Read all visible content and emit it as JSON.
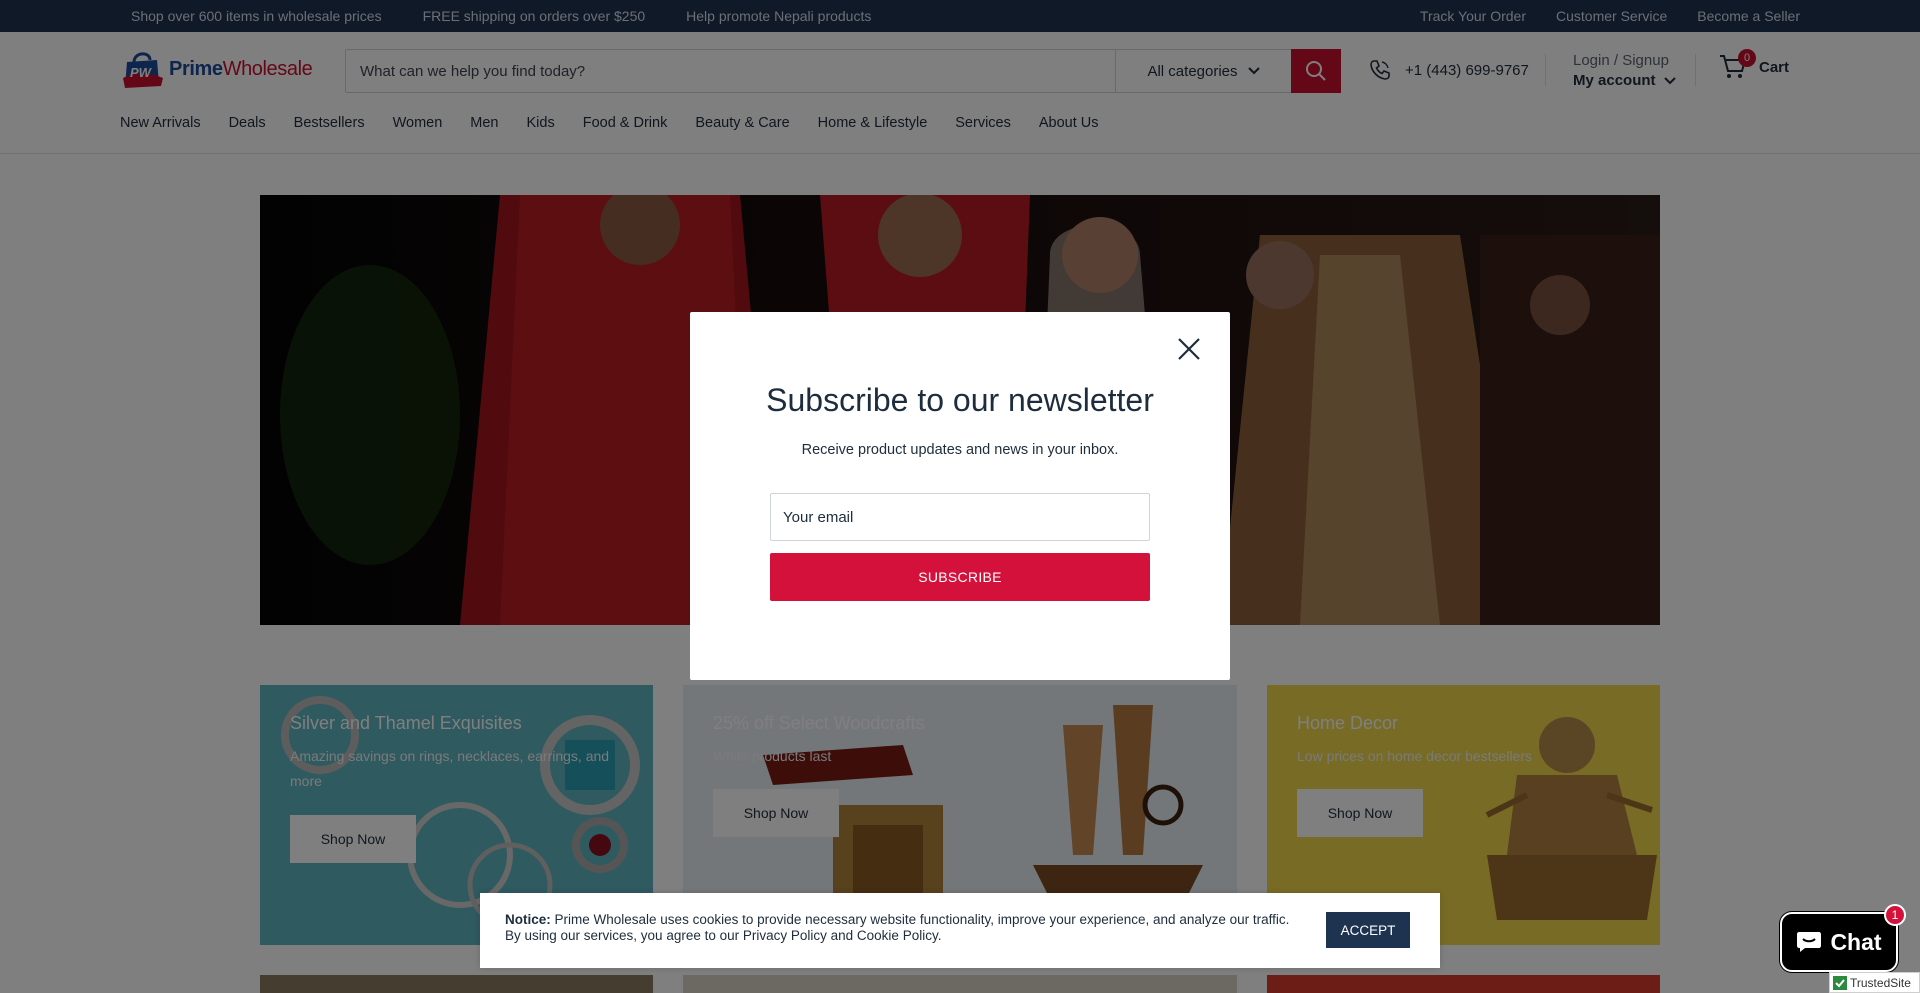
{
  "topbar": {
    "left": [
      "Shop over 600 items in wholesale prices",
      "FREE shipping on orders over $250",
      "Help promote Nepali products"
    ],
    "right": [
      "Track Your Order",
      "Customer Service",
      "Become a Seller"
    ]
  },
  "header": {
    "logo_part1": "Prime",
    "logo_part2": "Wholesale",
    "search_placeholder": "What can we help you find today?",
    "category_label": "All categories",
    "phone": "+1 (443) 699-9767",
    "login_label": "Login / Signup",
    "account_label": "My account",
    "cart_label": "Cart",
    "cart_count": "0"
  },
  "nav": [
    "New Arrivals",
    "Deals",
    "Bestsellers",
    "Women",
    "Men",
    "Kids",
    "Food & Drink",
    "Beauty & Care",
    "Home & Lifestyle",
    "Services",
    "About Us"
  ],
  "tiles": [
    {
      "title": "Silver and Thamel Exquisites",
      "desc_line1": "Amazing savings on rings, necklaces, earrings, and",
      "desc_line2": "more",
      "cta": "Shop Now"
    },
    {
      "title": "25% off Select Woodcrafts",
      "desc_line1": "While products last",
      "desc_line2": "",
      "cta": "Shop Now"
    },
    {
      "title": "Home Decor",
      "desc_line1": "Low prices on home decor bestsellers",
      "desc_line2": "",
      "cta": "Shop Now"
    }
  ],
  "modal": {
    "title": "Subscribe to our newsletter",
    "subtitle": "Receive product updates and news in your inbox.",
    "email_placeholder": "Your email",
    "button": "SUBSCRIBE"
  },
  "cookie": {
    "notice_label": "Notice:",
    "text": " Prime Wholesale uses cookies to provide necessary website functionality, improve your experience, and analyze our traffic. By using our services, you agree to our Privacy Policy and Cookie Policy.",
    "accept": "ACCEPT"
  },
  "chat": {
    "label": "Chat",
    "badge": "1"
  },
  "trusted": {
    "label": "TrustedSite"
  },
  "colors": {
    "brand_red": "#c8102e",
    "brand_navy": "#1e3350",
    "brand_blue": "#1d4a9b"
  }
}
